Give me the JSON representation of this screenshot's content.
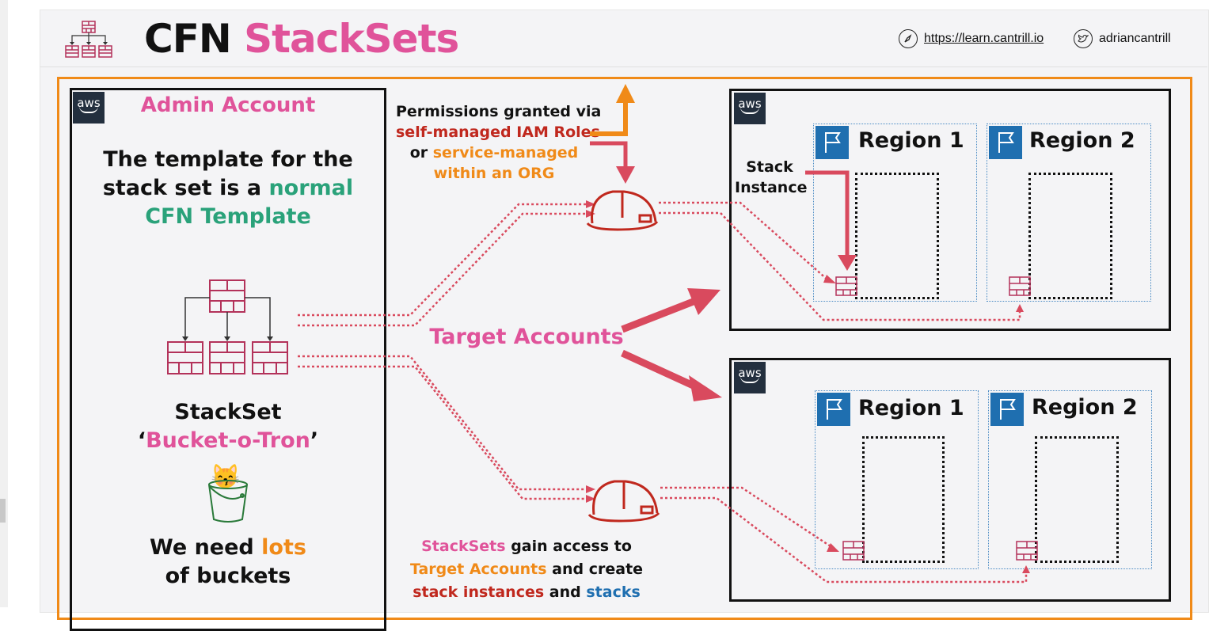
{
  "header": {
    "title_part1": "CFN",
    "title_part2": "StackSets",
    "website": "https://learn.cantrill.io",
    "twitter": "adriancantrill",
    "website_icon": "compass-icon",
    "twitter_icon": "twitter-icon"
  },
  "admin": {
    "title": "Admin Account",
    "line1": "The template for the",
    "line2_prefix": "stack set is a ",
    "line2_highlight": "normal",
    "line3": "CFN Template",
    "stackset_label": "StackSet",
    "stackset_name_quote_open": "‘",
    "stackset_name": "Bucket-o-Tron",
    "stackset_name_quote_close": "’",
    "need_prefix": "We need ",
    "need_highlight": "lots",
    "need_line2": "of buckets",
    "cat_emoji": "😽"
  },
  "permissions": {
    "line1": "Permissions granted via",
    "line2": "self-managed IAM Roles",
    "line3_prefix": "or ",
    "line3_highlight": "service-managed",
    "line4": "within an ORG"
  },
  "target_accounts": "Target Accounts",
  "bottom_text": {
    "l1_a": "StackSets",
    "l1_b": " gain access to",
    "l2_a": "Target Accounts",
    "l2_b": " and create",
    "l3_a": "stack instances",
    "l3_b": " and ",
    "l3_c": "stacks"
  },
  "aws_logo_text": "aws",
  "regions": {
    "r1": "Region 1",
    "r2": "Region 2"
  },
  "stack_instance": {
    "line1": "Stack",
    "line2": "Instance"
  },
  "colors": {
    "pink": "#e0539a",
    "green": "#2aa27a",
    "orange": "#f08a18",
    "red": "#c0281e",
    "blue": "#1f6fb0",
    "arrow_red": "#d94a5e",
    "template_crimson": "#b3325a"
  }
}
